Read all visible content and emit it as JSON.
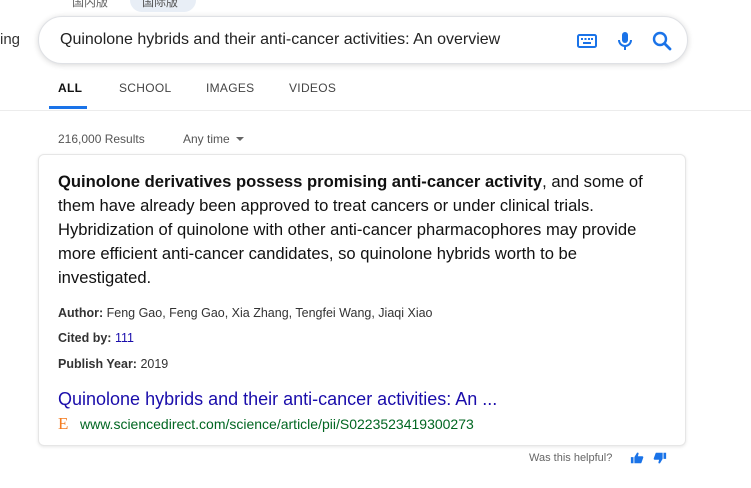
{
  "top_pills": {
    "domestic": "国内版",
    "international": "国际版"
  },
  "left_clip_text": "ing",
  "search": {
    "query": "Quinolone hybrids and their anti-cancer activities: An overview"
  },
  "tabs": [
    {
      "label": "ALL",
      "active": true
    },
    {
      "label": "SCHOOL",
      "active": false
    },
    {
      "label": "IMAGES",
      "active": false
    },
    {
      "label": "VIDEOS",
      "active": false
    }
  ],
  "results_meta": {
    "count": "216,000 Results",
    "time_filter": "Any time"
  },
  "answer": {
    "snippet_bold": "Quinolone derivatives possess promising anti-cancer activity",
    "snippet_rest": ", and some of them have already been approved to treat cancers or under clinical trials. Hybridization of quinolone with other anti-cancer pharmacophores may provide more efficient anti-cancer candidates, so quinolone hybrids worth to be investigated.",
    "author_label": "Author:",
    "author_value": "Feng Gao, Feng Gao, Xia Zhang, Tengfei Wang, Jiaqi Xiao",
    "cited_label": "Cited by:",
    "cited_value": "111",
    "year_label": "Publish Year:",
    "year_value": "2019",
    "title": "Quinolone hybrids and their anti-cancer activities: An ...",
    "url": "www.sciencedirect.com/science/article/pii/S0223523419300273",
    "favicon_letter": "E"
  },
  "feedback": {
    "question": "Was this helpful?"
  },
  "colors": {
    "accent": "#1a73e8",
    "link": "#1a0dab",
    "url_green": "#006621",
    "favicon_orange": "#f47b20"
  },
  "icons": [
    "keyboard-icon",
    "microphone-icon",
    "search-icon",
    "thumbs-up-icon",
    "thumbs-down-icon"
  ]
}
